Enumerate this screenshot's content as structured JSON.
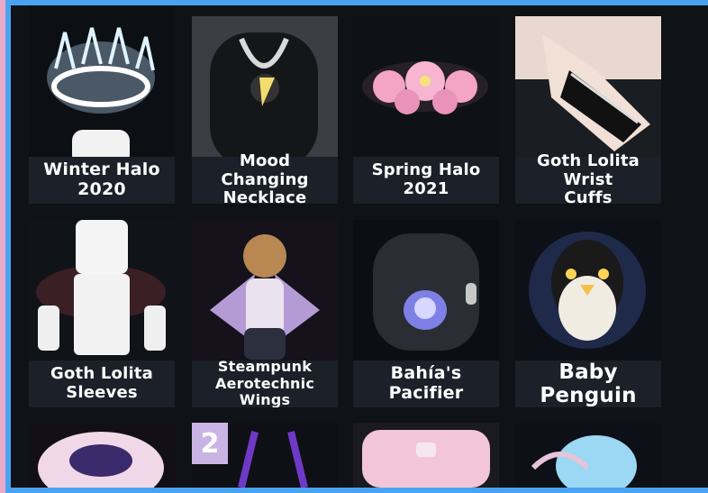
{
  "inventory": {
    "items": [
      {
        "name": "Winter Halo\n2020"
      },
      {
        "name": "Mood Changing\nNecklace"
      },
      {
        "name": "Spring Halo 2021"
      },
      {
        "name": "Goth Lolita Wrist\nCuffs"
      },
      {
        "name": "Goth Lolita\nSleeves"
      },
      {
        "name": "Steampunk\nAerotechnic Wings"
      },
      {
        "name": "Bahía's Pacifier"
      },
      {
        "name": "Baby Penguin"
      }
    ],
    "badge_count": "2"
  },
  "colors": {
    "background": "#4aa3f0",
    "panel": "#0f1216",
    "caption": "#1b2029",
    "badge": "#c9b4e3",
    "left_edge": "#e9a9c8"
  }
}
